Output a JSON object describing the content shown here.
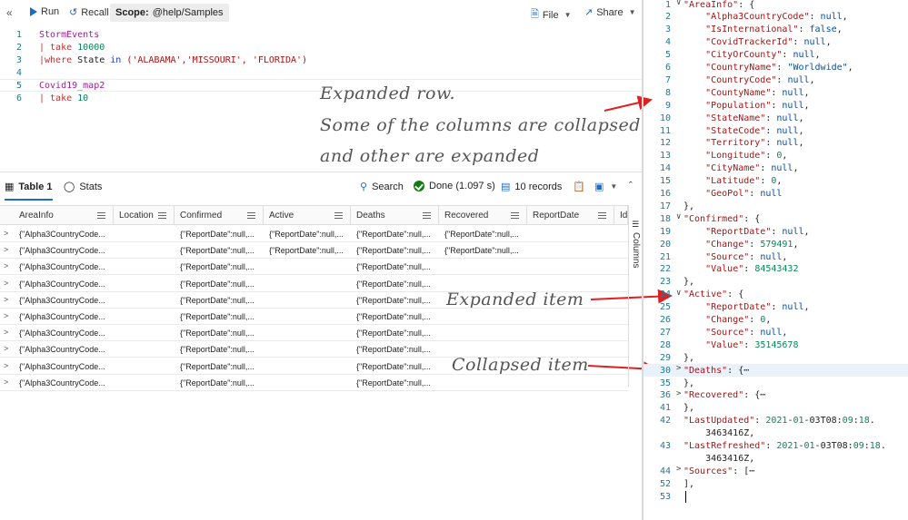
{
  "toolbar": {
    "run": "Run",
    "recall": "Recall",
    "scope_label": "Scope:",
    "scope_value": "@help/Samples",
    "file": "File",
    "share": "Share"
  },
  "editor": {
    "lines": [
      {
        "num": "1",
        "parts": [
          {
            "t": "StormEvents",
            "c": "kw-table"
          }
        ]
      },
      {
        "num": "2",
        "parts": [
          {
            "t": "| take ",
            "c": "kw-op"
          },
          {
            "t": "10000",
            "c": "kw-num"
          }
        ]
      },
      {
        "num": "3",
        "parts": [
          {
            "t": "|where ",
            "c": "kw-op"
          },
          {
            "t": "State ",
            "c": ""
          },
          {
            "t": "in ",
            "c": "kw-kw"
          },
          {
            "t": "('ALABAMA','MISSOURI', 'FLORIDA')",
            "c": "kw-str"
          }
        ]
      },
      {
        "num": "4",
        "parts": []
      },
      {
        "num": "5",
        "parts": [
          {
            "t": "Covid19_map2",
            "c": "kw-table"
          }
        ]
      },
      {
        "num": "6",
        "parts": [
          {
            "t": "| take ",
            "c": "kw-op"
          },
          {
            "t": "10",
            "c": "kw-num"
          }
        ]
      }
    ]
  },
  "annotations": {
    "top1": "Expanded row.",
    "top2": "Some of the columns are collapsed",
    "top3": "and other are expanded",
    "expanded_item": "Expanded item",
    "collapsed_item": "Collapsed item"
  },
  "results": {
    "tab_table": "Table 1",
    "tab_stats": "Stats",
    "search": "Search",
    "done": "Done (1.097 s)",
    "records": "10 records",
    "columns_label": "Columns"
  },
  "grid": {
    "columns": [
      "AreaInfo",
      "Location",
      "Confirmed",
      "Active",
      "Deaths",
      "Recovered",
      "ReportDate",
      "Id"
    ],
    "rows": [
      [
        "{\"Alpha3CountryCode...",
        "",
        "{\"ReportDate\":null,...",
        "{\"ReportDate\":null,...",
        "{\"ReportDate\":null,...",
        "{\"ReportDate\":null,...",
        "",
        ""
      ],
      [
        "{\"Alpha3CountryCode...",
        "",
        "{\"ReportDate\":null,...",
        "{\"ReportDate\":null,...",
        "{\"ReportDate\":null,...",
        "{\"ReportDate\":null,...",
        "",
        ""
      ],
      [
        "{\"Alpha3CountryCode...",
        "",
        "{\"ReportDate\":null,...",
        "",
        "{\"ReportDate\":null,...",
        "",
        "",
        ""
      ],
      [
        "{\"Alpha3CountryCode...",
        "",
        "{\"ReportDate\":null,...",
        "",
        "{\"ReportDate\":null,...",
        "",
        "",
        ""
      ],
      [
        "{\"Alpha3CountryCode...",
        "",
        "{\"ReportDate\":null,...",
        "",
        "{\"ReportDate\":null,...",
        "",
        "",
        ""
      ],
      [
        "{\"Alpha3CountryCode...",
        "",
        "{\"ReportDate\":null,...",
        "",
        "{\"ReportDate\":null,...",
        "",
        "",
        ""
      ],
      [
        "{\"Alpha3CountryCode...",
        "",
        "{\"ReportDate\":null,...",
        "",
        "{\"ReportDate\":null,...",
        "",
        "",
        ""
      ],
      [
        "{\"Alpha3CountryCode...",
        "",
        "{\"ReportDate\":null,...",
        "",
        "{\"ReportDate\":null,...",
        "",
        "",
        ""
      ],
      [
        "{\"Alpha3CountryCode...",
        "",
        "{\"ReportDate\":null,...",
        "",
        "{\"ReportDate\":null,...",
        "",
        "",
        ""
      ],
      [
        "{\"Alpha3CountryCode...",
        "",
        "{\"ReportDate\":null,...",
        "",
        "{\"ReportDate\":null,...",
        "",
        "",
        ""
      ]
    ]
  },
  "json_view": {
    "lines": [
      {
        "n": "1",
        "chev": "v",
        "t": "\"AreaInfo\": {"
      },
      {
        "n": "2",
        "t": "    \"Alpha3CountryCode\": null,"
      },
      {
        "n": "3",
        "t": "    \"IsInternational\": false,"
      },
      {
        "n": "4",
        "t": "    \"CovidTrackerId\": null,"
      },
      {
        "n": "5",
        "t": "    \"CityOrCounty\": null,"
      },
      {
        "n": "6",
        "t": "    \"CountryName\": \"Worldwide\","
      },
      {
        "n": "7",
        "t": "    \"CountryCode\": null,"
      },
      {
        "n": "8",
        "t": "    \"CountyName\": null,"
      },
      {
        "n": "9",
        "t": "    \"Population\": null,"
      },
      {
        "n": "10",
        "t": "    \"StateName\": null,"
      },
      {
        "n": "11",
        "t": "    \"StateCode\": null,"
      },
      {
        "n": "12",
        "t": "    \"Territory\": null,"
      },
      {
        "n": "13",
        "t": "    \"Longitude\": 0,"
      },
      {
        "n": "14",
        "t": "    \"CityName\": null,"
      },
      {
        "n": "15",
        "t": "    \"Latitude\": 0,"
      },
      {
        "n": "16",
        "t": "    \"GeoPol\": null"
      },
      {
        "n": "17",
        "t": "},"
      },
      {
        "n": "18",
        "chev": "v",
        "t": "\"Confirmed\": {"
      },
      {
        "n": "19",
        "t": "    \"ReportDate\": null,"
      },
      {
        "n": "20",
        "t": "    \"Change\": 579491,"
      },
      {
        "n": "21",
        "t": "    \"Source\": null,"
      },
      {
        "n": "22",
        "t": "    \"Value\": 84543432"
      },
      {
        "n": "23",
        "t": "},"
      },
      {
        "n": "24",
        "chev": "v",
        "t": "\"Active\": {"
      },
      {
        "n": "25",
        "t": "    \"ReportDate\": null,"
      },
      {
        "n": "26",
        "t": "    \"Change\": 0,"
      },
      {
        "n": "27",
        "t": "    \"Source\": null,"
      },
      {
        "n": "28",
        "t": "    \"Value\": 35145678"
      },
      {
        "n": "29",
        "t": "},"
      },
      {
        "n": "30",
        "chev": ">",
        "t": "\"Deaths\": {⋯",
        "hl": true
      },
      {
        "n": "35",
        "t": "},"
      },
      {
        "n": "36",
        "chev": ">",
        "t": "\"Recovered\": {⋯"
      },
      {
        "n": "41",
        "t": "},"
      },
      {
        "n": "42",
        "t": "\"LastUpdated\": 2021-01-03T08:09:18."
      },
      {
        "n": "",
        "t": "    3463416Z,"
      },
      {
        "n": "43",
        "t": "\"LastRefreshed\": 2021-01-03T08:09:18."
      },
      {
        "n": "",
        "t": "    3463416Z,"
      },
      {
        "n": "44",
        "chev": ">",
        "t": "\"Sources\": [⋯"
      },
      {
        "n": "52",
        "t": "],"
      },
      {
        "n": "53",
        "t": ""
      }
    ]
  },
  "colors": {
    "accent": "#1e6bc7",
    "arrow": "#e02020",
    "done": "#107c10"
  }
}
